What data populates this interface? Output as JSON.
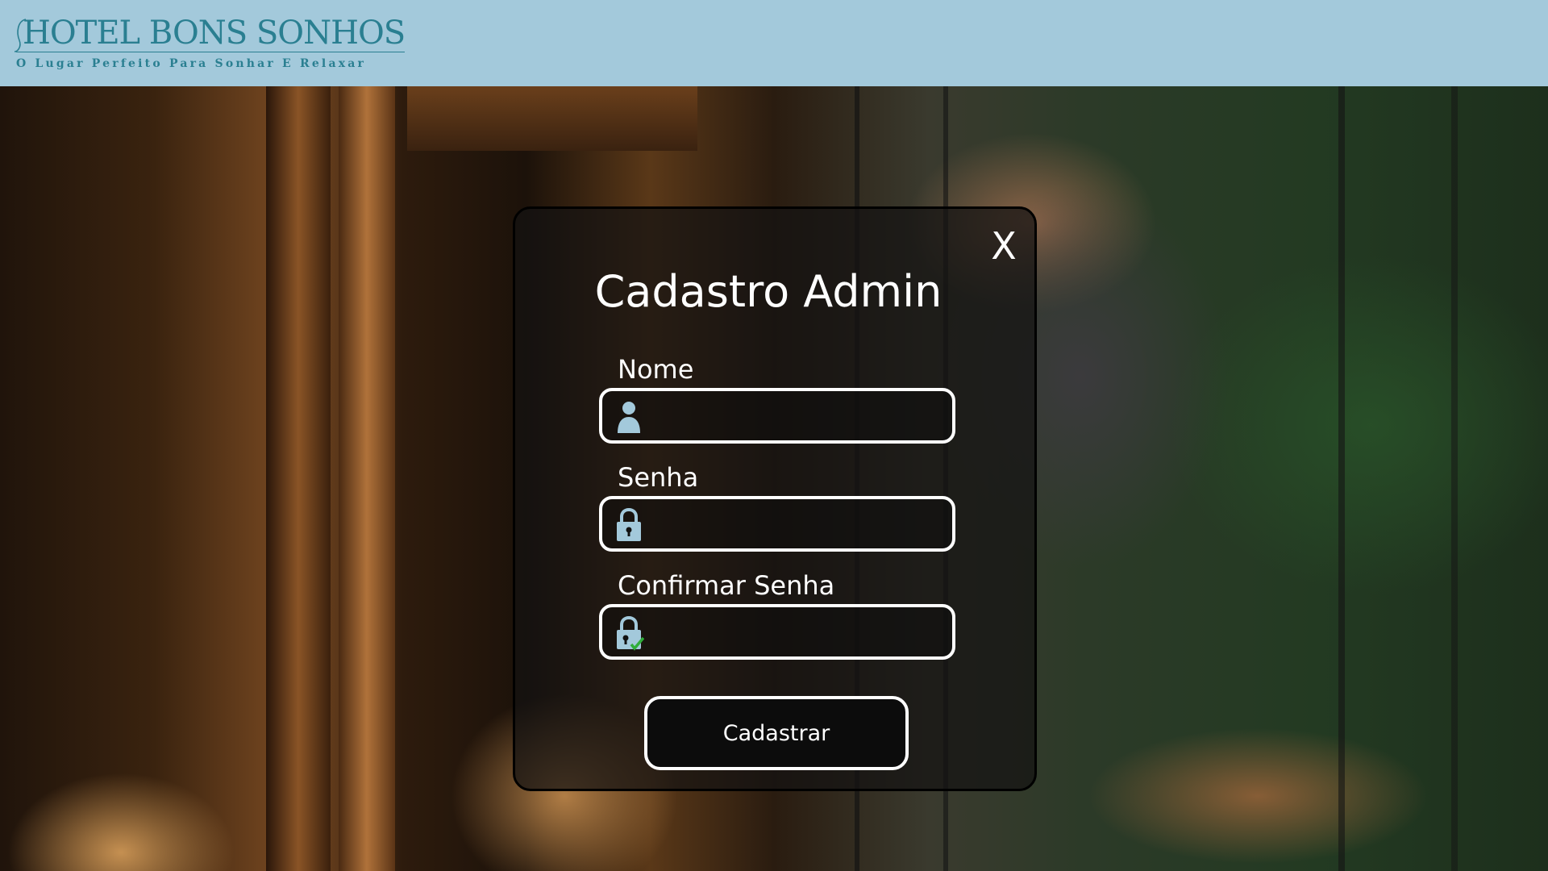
{
  "header": {
    "logo_title": "HOTEL BONS SONHOS",
    "logo_tagline": "O Lugar Perfeito Para Sonhar E Relaxar"
  },
  "modal": {
    "close_label": "X",
    "title": "Cadastro Admin",
    "fields": [
      {
        "label": "Nome",
        "value": "",
        "icon": "user-icon"
      },
      {
        "label": "Senha",
        "value": "",
        "icon": "lock-icon"
      },
      {
        "label": "Confirmar Senha",
        "value": "",
        "icon": "lock-check-icon"
      }
    ],
    "submit_label": "Cadastrar"
  },
  "colors": {
    "header_bg": "#a3c9db",
    "logo": "#2a7f91",
    "icon": "#a3c9db",
    "check": "#2fae3a"
  }
}
